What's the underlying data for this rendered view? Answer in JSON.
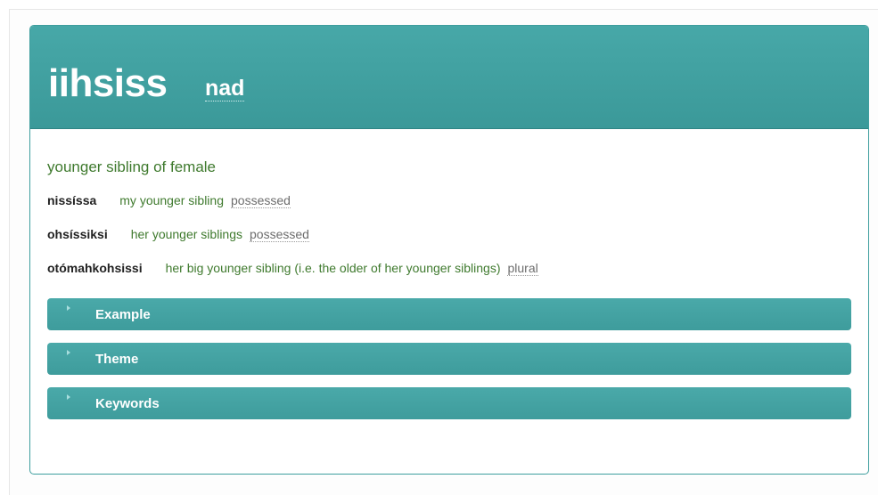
{
  "entry": {
    "headword": "iihsiss",
    "part_of_speech": "nad",
    "definition": "younger sibling of female",
    "forms": [
      {
        "word": "nissíssa",
        "gloss": "my younger sibling",
        "grammar": "possessed"
      },
      {
        "word": "ohsíssiksi",
        "gloss": "her younger siblings",
        "grammar": "possessed"
      },
      {
        "word": "otómahkohsissi",
        "gloss": "her big younger sibling (i.e. the older of her younger siblings)",
        "grammar": "plural"
      }
    ],
    "sections": [
      {
        "label": "Example"
      },
      {
        "label": "Theme"
      },
      {
        "label": "Keywords"
      }
    ]
  },
  "icons": {
    "section_toggle": "caret-right-icon"
  },
  "colors": {
    "header_bg": "#43a3a3",
    "definition_text": "#3f7a2e",
    "section_bar": "#44a4a4"
  }
}
